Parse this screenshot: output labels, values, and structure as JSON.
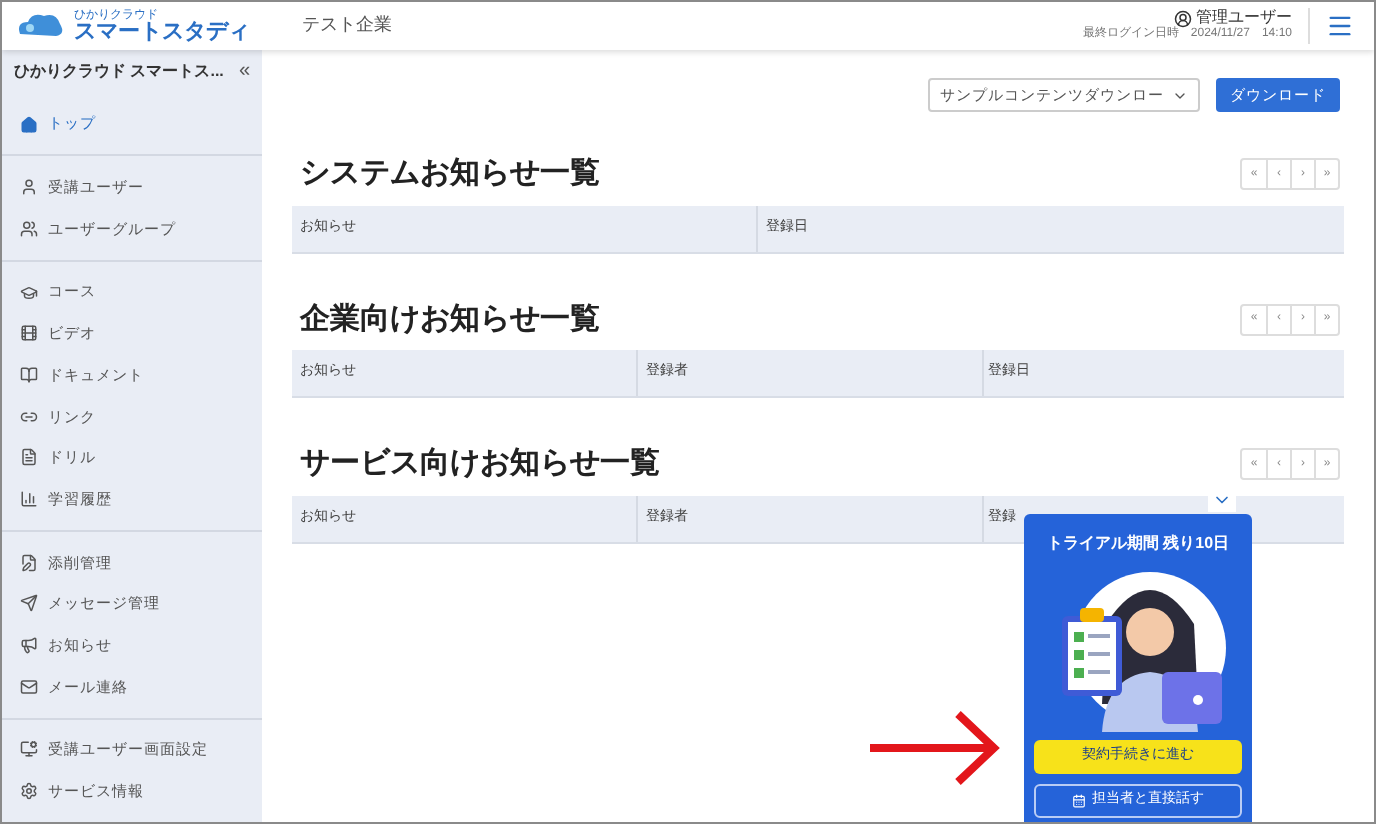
{
  "header": {
    "logo_top": "ひかりクラウド",
    "logo_main": "スマートスタディ",
    "company": "テスト企業",
    "user": "管理ユーザー",
    "last_login_label": "最終ログイン日時",
    "last_login": "2024/11/27　14:10"
  },
  "sidebar": {
    "title": "ひかりクラウド スマートス...",
    "collapse": "«",
    "groups": [
      [
        {
          "label": "トップ",
          "selected": true
        }
      ],
      [
        {
          "label": "受講ユーザー",
          "selected": false
        },
        {
          "label": "ユーザーグループ",
          "selected": false
        }
      ],
      [
        {
          "label": "コース",
          "selected": false
        },
        {
          "label": "ビデオ",
          "selected": false
        },
        {
          "label": "ドキュメント",
          "selected": false
        },
        {
          "label": "リンク",
          "selected": false
        },
        {
          "label": "ドリル",
          "selected": false
        },
        {
          "label": "学習履歴",
          "selected": false
        }
      ],
      [
        {
          "label": "添削管理",
          "selected": false
        },
        {
          "label": "メッセージ管理",
          "selected": false
        },
        {
          "label": "お知らせ",
          "selected": false
        },
        {
          "label": "メール連絡",
          "selected": false
        }
      ],
      [
        {
          "label": "受講ユーザー画面設定",
          "selected": false
        },
        {
          "label": "サービス情報",
          "selected": false
        }
      ]
    ]
  },
  "toolbar": {
    "select_value": "サンプルコンテンツダウンロー",
    "button": "ダウンロード"
  },
  "sections": [
    {
      "title": "システムお知らせ一覧",
      "pager": [
        "«",
        "‹",
        "›",
        "»"
      ],
      "columns": [
        "お知らせ",
        "登録日"
      ]
    },
    {
      "title": "企業向けお知らせ一覧",
      "pager": [
        "«",
        "‹",
        "›",
        "»"
      ],
      "columns": [
        "お知らせ",
        "登録者",
        "登録日"
      ]
    },
    {
      "title": "サービス向けお知らせ一覧",
      "pager": [
        "«",
        "‹",
        "›",
        "»"
      ],
      "columns": [
        "お知らせ",
        "登録者",
        "登録"
      ]
    }
  ],
  "popup": {
    "title": "トライアル期間 残り10日",
    "primary": "契約手続きに進む",
    "secondary": "担当者と直接話す"
  }
}
